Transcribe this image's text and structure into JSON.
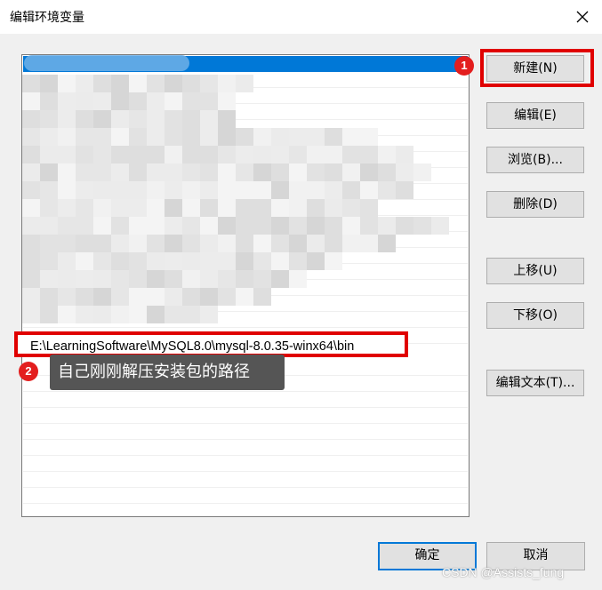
{
  "window": {
    "title": "编辑环境变量",
    "close_icon": "close-icon"
  },
  "list": {
    "path_entry": "E:\\LearningSoftware\\MySQL8.0\\mysql-8.0.35-winx64\\bin"
  },
  "buttons": {
    "new": "新建(N)",
    "edit": "编辑(E)",
    "browse": "浏览(B)...",
    "delete": "删除(D)",
    "move_up": "上移(U)",
    "move_down": "下移(O)",
    "edit_text": "编辑文本(T)...",
    "ok": "确定",
    "cancel": "取消"
  },
  "annotations": {
    "marker1": "1",
    "marker2": "2",
    "tooltip": "自己刚刚解压安装包的路径",
    "highlight_color": "#e00000"
  },
  "watermark": "CSDN @Assists_fung",
  "colors": {
    "selection": "#0078d7",
    "dialog_bg": "#f0f0f0"
  }
}
